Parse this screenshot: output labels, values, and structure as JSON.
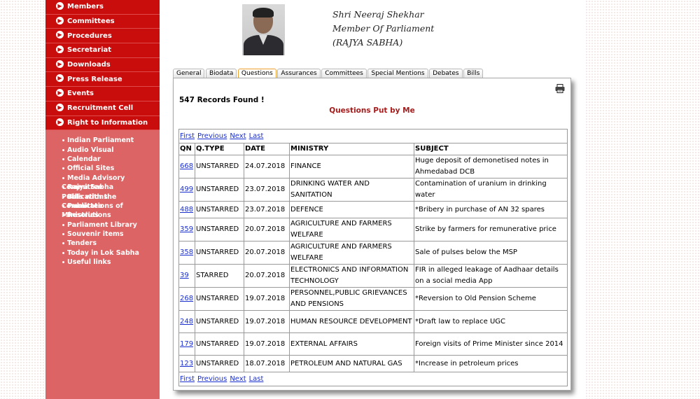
{
  "sidebar": {
    "menu": [
      "Members",
      "Committees",
      "Procedures",
      "Secretariat",
      "Downloads",
      "Press Release",
      "Events",
      "Recruitment Cell",
      "Right to Information"
    ],
    "links": [
      "Indian Parliament",
      "Audio Visual",
      "Calendar",
      "Official Sites",
      "Media Advisory Committee",
      "Rajya Sabha Publications",
      "Bills with the Committee",
      "Publications of Ministries",
      "Resolutions",
      "Parliament Library",
      "Souvenir items",
      "Tenders",
      "Today in Lok Sabha",
      "Useful links"
    ]
  },
  "header": {
    "name": "Shri Neeraj Shekhar",
    "designation": "Member Of Parliament",
    "house": "(RAJYA SABHA)"
  },
  "tabs": [
    "General",
    "Biodata",
    "Questions",
    "Assurances",
    "Committees",
    "Special Mentions",
    "Debates",
    "Bills"
  ],
  "active_tab": "Questions",
  "panel": {
    "records": "547 Records Found !",
    "title": "Questions Put by Me",
    "pager": {
      "first": "First",
      "previous": "Previous",
      "next": "Next",
      "last": "Last"
    },
    "columns": [
      "QN",
      "Q.TYPE",
      "DATE",
      "MINISTRY",
      "SUBJECT"
    ],
    "rows": [
      {
        "qn": "668",
        "type": "UNSTARRED",
        "date": "24.07.2018",
        "ministry": "FINANCE",
        "subject": "Huge deposit of demonetised notes in Ahmedabad DCB"
      },
      {
        "qn": "499",
        "type": "UNSTARRED",
        "date": "23.07.2018",
        "ministry": "DRINKING WATER AND SANITATION",
        "subject": "Contamination of uranium in drinking water"
      },
      {
        "qn": "488",
        "type": "UNSTARRED",
        "date": "23.07.2018",
        "ministry": "DEFENCE",
        "subject": "*Bribery in purchase of AN 32 spares"
      },
      {
        "qn": "359",
        "type": "UNSTARRED",
        "date": "20.07.2018",
        "ministry": "AGRICULTURE AND FARMERS WELFARE",
        "subject": "Strike by farmers for remunerative price"
      },
      {
        "qn": "358",
        "type": "UNSTARRED",
        "date": "20.07.2018",
        "ministry": "AGRICULTURE AND FARMERS WELFARE",
        "subject": "Sale of pulses below the MSP"
      },
      {
        "qn": "39",
        "type": "STARRED",
        "date": "20.07.2018",
        "ministry": "ELECTRONICS AND INFORMATION TECHNOLOGY",
        "subject": "FIR in alleged leakage of Aadhaar details on a social media App"
      },
      {
        "qn": "268",
        "type": "UNSTARRED",
        "date": "19.07.2018",
        "ministry": "PERSONNEL,PUBLIC GRIEVANCES AND PENSIONS",
        "subject": "*Reversion to Old Pension Scheme"
      },
      {
        "qn": "248",
        "type": "UNSTARRED",
        "date": "19.07.2018",
        "ministry": "HUMAN RESOURCE DEVELOPMENT",
        "subject": "*Draft law to replace UGC"
      },
      {
        "qn": "179",
        "type": "UNSTARRED",
        "date": "19.07.2018",
        "ministry": "EXTERNAL AFFAIRS",
        "subject": "Foreign visits of Prime Minister since 2014"
      },
      {
        "qn": "123",
        "type": "UNSTARRED",
        "date": "18.07.2018",
        "ministry": "PETROLEUM AND NATURAL GAS",
        "subject": "*Increase in petroleum prices"
      }
    ]
  },
  "colors": {
    "menu_bg": "#c90d0d",
    "sidebar_bg": "#dd6464",
    "title_color": "#a61c1c",
    "link": "#1a2fcf",
    "active_tab_border": "#f0a030"
  },
  "icons": {
    "print": "printer-icon",
    "menu_bullet": "arrow-circle-icon"
  }
}
